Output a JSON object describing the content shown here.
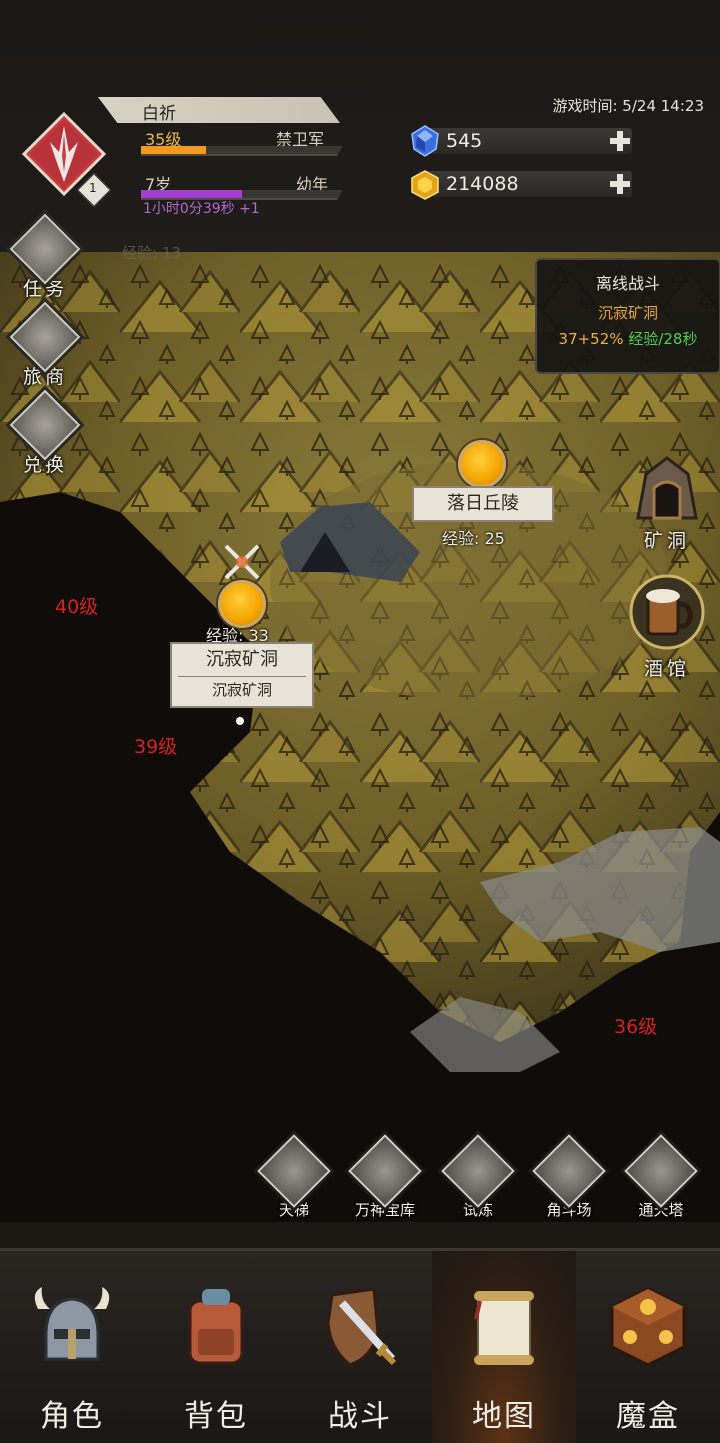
{
  "player": {
    "name": "白祈",
    "level": "35级",
    "rank": "禁卫军",
    "level_progress": 0.32,
    "age": "7岁",
    "age_stage": "幼年",
    "age_progress": 0.5,
    "age_timer": "1小时0分39秒 +1",
    "emblem_badge": "1"
  },
  "game_time": "游戏时间: 5/24 14:23",
  "currency": {
    "diamonds": "545",
    "gold": "214088"
  },
  "side_menu": [
    {
      "label": "任务",
      "icon": "target-icon"
    },
    {
      "label": "旅商",
      "icon": "merchant-box-icon"
    },
    {
      "label": "兑换",
      "icon": "exchange-icon"
    }
  ],
  "offline_battle": {
    "title": "离线战斗",
    "location": "沉寂矿洞",
    "rate_value": "37+52%",
    "rate_suffix": "经验/28秒"
  },
  "map": {
    "nodes": [
      {
        "title": "落日丘陵",
        "exp": "经验: 25"
      },
      {
        "title": "沉寂矿洞",
        "subtitle": "沉寂矿洞",
        "exp": "经验: 33"
      }
    ],
    "zone_levels": [
      "40级",
      "39级",
      "36级"
    ],
    "faded_text": "经验: 13",
    "right_buttons": [
      {
        "label": "矿洞",
        "icon": "mine-cave-icon"
      },
      {
        "label": "酒馆",
        "icon": "tavern-mug-icon"
      }
    ]
  },
  "features": [
    {
      "label": "天梯",
      "icon": "ladder-sword-icon"
    },
    {
      "label": "万神宝库",
      "icon": "treasure-scroll-icon"
    },
    {
      "label": "试炼",
      "icon": "trial-sword-icon"
    },
    {
      "label": "角斗场",
      "icon": "arena-helmet-icon"
    },
    {
      "label": "通天塔",
      "icon": "tower-gate-icon"
    }
  ],
  "nav": [
    {
      "label": "角色",
      "icon": "viking-helmet-icon"
    },
    {
      "label": "背包",
      "icon": "backpack-icon"
    },
    {
      "label": "战斗",
      "icon": "sword-shield-icon"
    },
    {
      "label": "地图",
      "icon": "map-scroll-icon",
      "active": true
    },
    {
      "label": "魔盒",
      "icon": "magic-box-icon"
    }
  ],
  "colors": {
    "level_text": "#e9b949",
    "age_timer": "#b16ad0",
    "zone_level": "#d6231c",
    "offline_location": "#e2a93b",
    "offline_rate_value": "#f0b23a",
    "offline_rate_suffix": "#4fd24f"
  }
}
